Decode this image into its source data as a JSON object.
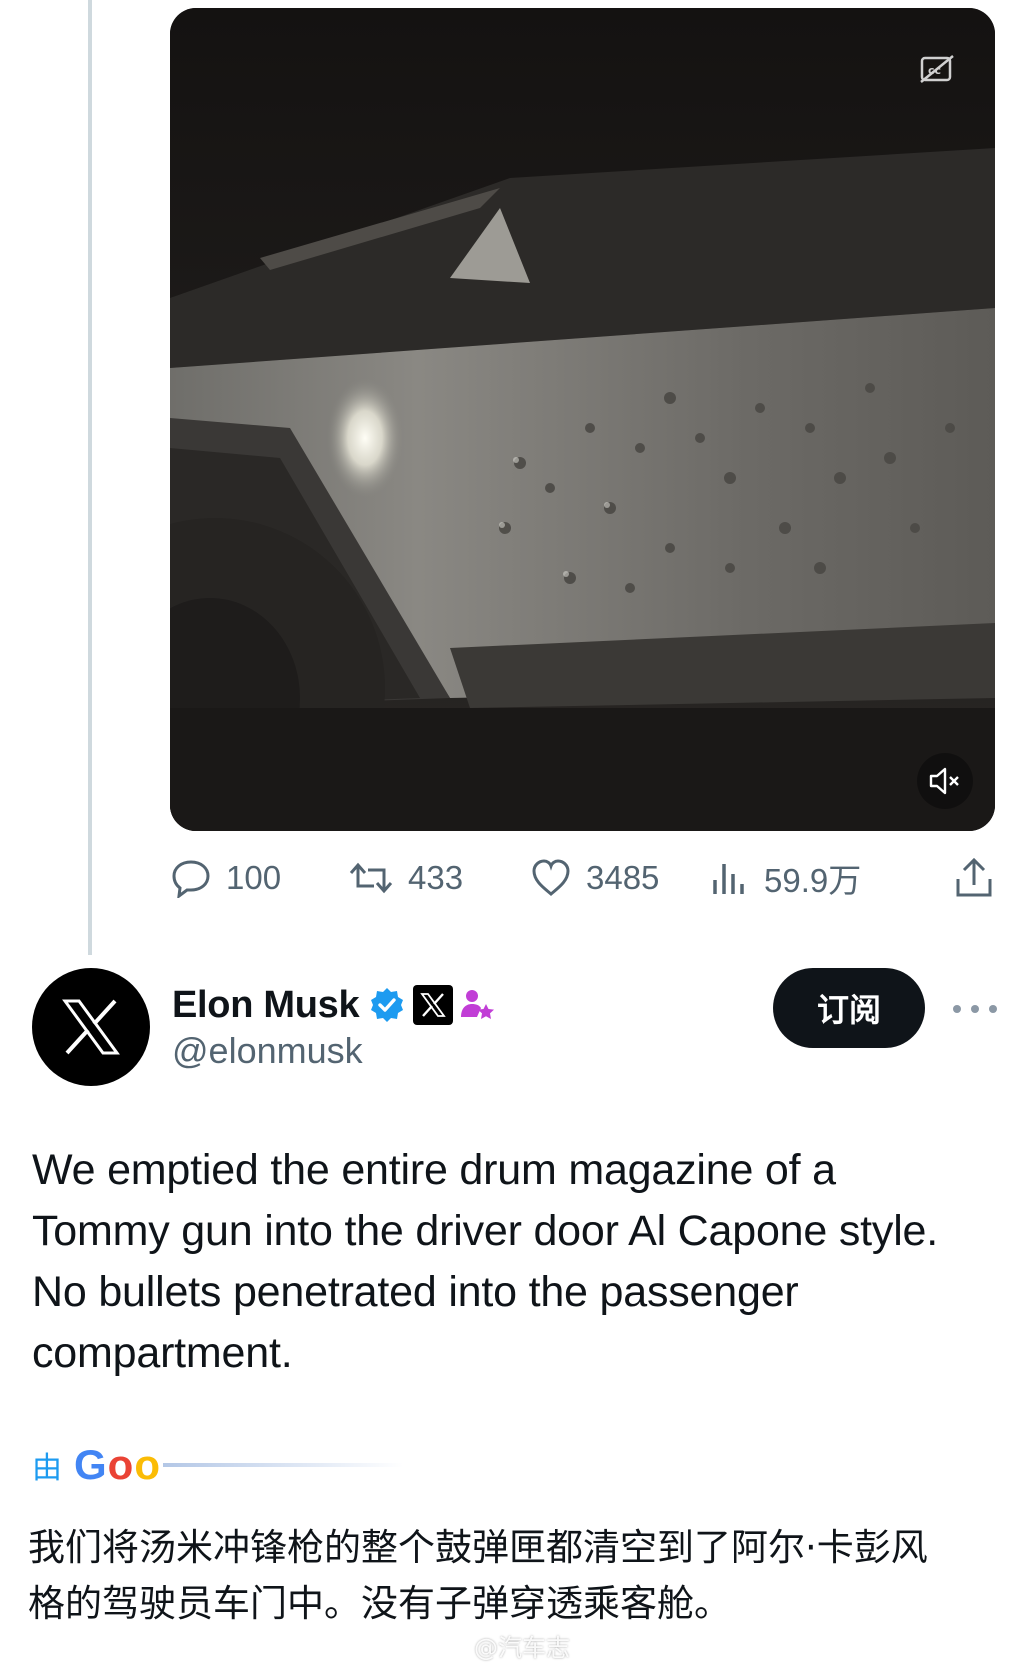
{
  "media": {
    "cc_icon": "captions-off-icon",
    "mute_icon": "volume-muted-icon"
  },
  "actions": {
    "replies": "100",
    "retweets": "433",
    "likes": "3485",
    "views": "59.9万"
  },
  "author": {
    "display_name": "Elon Musk",
    "handle": "@elonmusk",
    "subscribe_label": "订阅",
    "avatar_icon": "x-logo-icon"
  },
  "tweet": {
    "text": "We emptied the entire drum magazine of a\nTommy gun into the driver door Al Capone style.\nNo bullets penetrated into the passenger\ncompartment."
  },
  "translation": {
    "by_label": "由",
    "provider_partial": "Goo",
    "text": "我们将汤米冲锋枪的整个鼓弹匣都清空到了阿尔·卡彭风\n格的驾驶员车门中。没有子弹穿透乘客舱。"
  },
  "watermark": {
    "text": "@汽车志"
  },
  "colors": {
    "verified_blue": "#1d9bf0",
    "role_purple": "#c13ed6",
    "muted_text": "#536471"
  }
}
